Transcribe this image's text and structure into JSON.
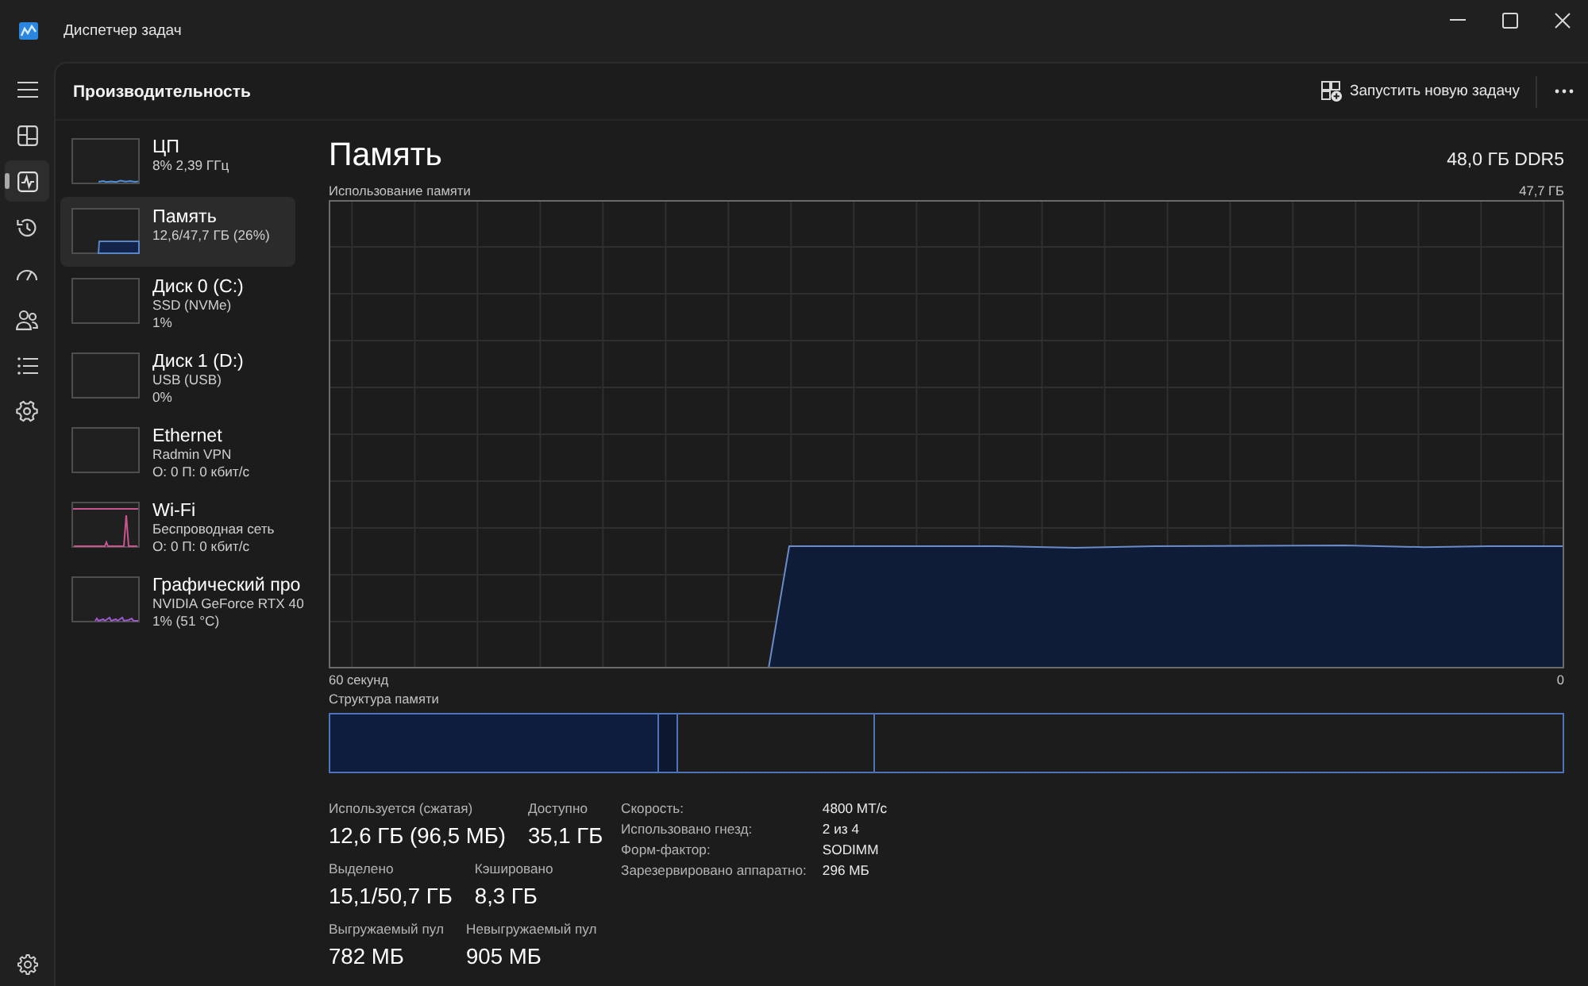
{
  "window": {
    "title": "Диспетчер задач"
  },
  "nav": [
    {
      "kind": "processes",
      "selected": false
    },
    {
      "kind": "performance",
      "selected": true
    },
    {
      "kind": "history",
      "selected": false
    },
    {
      "kind": "startup",
      "selected": false
    },
    {
      "kind": "users",
      "selected": false
    },
    {
      "kind": "details",
      "selected": false
    },
    {
      "kind": "services",
      "selected": false
    }
  ],
  "header": {
    "title": "Производительность",
    "run_task_button": "Запустить новую задачу"
  },
  "sidebar": {
    "items": [
      {
        "title": "ЦП",
        "details": [
          "8% 2,39 ГГц"
        ],
        "kind": "line",
        "color": "#4b8fd8",
        "selected": false
      },
      {
        "title": "Память",
        "details": [
          "12,6/47,7 ГБ (26%)"
        ],
        "kind": "area",
        "color": "#5a86c8",
        "selected": true
      },
      {
        "title": "Диск 0 (C:)",
        "details": [
          "SSD (NVMe)",
          "1%"
        ],
        "kind": "empty",
        "selected": false
      },
      {
        "title": "Диск 1 (D:)",
        "details": [
          "USB (USB)",
          "0%"
        ],
        "kind": "empty",
        "selected": false
      },
      {
        "title": "Ethernet",
        "details": [
          "Radmin VPN",
          "О: 0 П: 0 кбит/с"
        ],
        "kind": "empty",
        "selected": false
      },
      {
        "title": "Wi-Fi",
        "details": [
          "Беспроводная сеть",
          "О: 0 П: 0 кбит/с"
        ],
        "kind": "peak",
        "color": "#c9558f",
        "selected": false
      },
      {
        "title": "Графический про",
        "details": [
          "NVIDIA GeForce RTX 40",
          "1% (51 °C)"
        ],
        "kind": "ripple",
        "color": "#9b59c9",
        "selected": false
      }
    ]
  },
  "memory": {
    "title": "Память",
    "capacity": "48,0 ГБ DDR5",
    "usage_graph": {
      "title": "Использование памяти",
      "max_label": "47,7 ГБ",
      "start_label": "60 секунд",
      "end_label": "0"
    },
    "composition": {
      "title": "Структура памяти"
    },
    "stats": [
      {
        "items": [
          {
            "label": "Используется (сжатая)",
            "value": "12,6 ГБ (96,5 МБ)"
          },
          {
            "label": "Доступно",
            "value": "35,1 ГБ"
          }
        ]
      },
      {
        "items": [
          {
            "label": "Выделено",
            "value": "15,1/50,7 ГБ"
          },
          {
            "label": "Кэшировано",
            "value": "8,3 ГБ"
          }
        ]
      },
      {
        "items": [
          {
            "label": "Выгружаемый пул",
            "value": "782 МБ"
          },
          {
            "label": "Невыгружаемый пул",
            "value": "905 МБ"
          }
        ]
      }
    ],
    "properties": [
      {
        "label": "Скорость:",
        "value": "4800 МТ/с"
      },
      {
        "label": "Использовано гнезд:",
        "value": "2 из 4"
      },
      {
        "label": "Форм-фактор:",
        "value": "SODIMM"
      },
      {
        "label": "Зарезервировано аппаратно:",
        "value": "296 МБ"
      }
    ]
  }
}
